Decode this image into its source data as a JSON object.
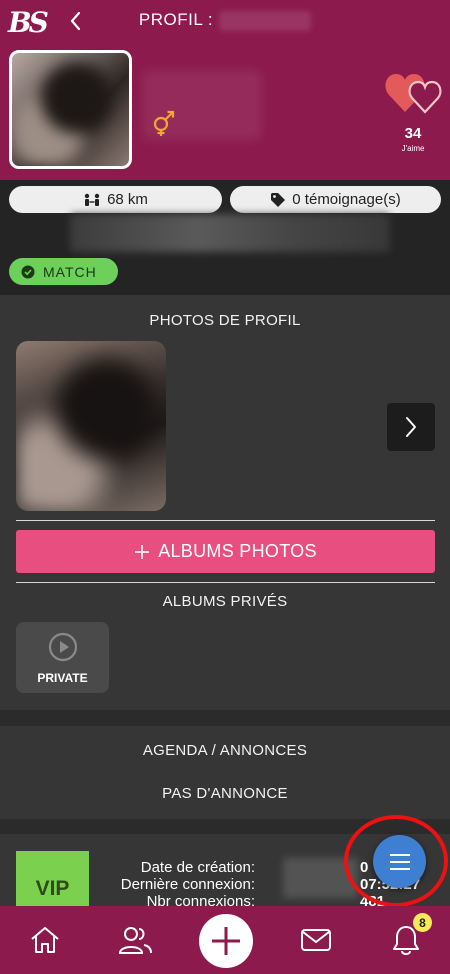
{
  "app": {
    "logo_text": "BS"
  },
  "header": {
    "title": "PROFIL :",
    "likes_count": "34",
    "likes_label": "J'aime"
  },
  "info": {
    "distance": "68 km",
    "testimonials": "0 témoignage(s)",
    "match_label": "MATCH"
  },
  "photos": {
    "section_title": "PHOTOS DE PROFIL",
    "albums_button": "ALBUMS PHOTOS",
    "private_title": "ALBUMS PRIVÉS",
    "private_tile_label": "PRIVATE"
  },
  "agenda": {
    "title": "AGENDA / ANNONCES",
    "empty_text": "PAS D'ANNONCE"
  },
  "vip": {
    "badge": "VIP",
    "rows": [
      {
        "label": "Date de création:",
        "value": "0"
      },
      {
        "label": "Dernière connexion:",
        "value": "07:52:27"
      },
      {
        "label": "Nbr connexions:",
        "value": "481"
      }
    ]
  },
  "nav": {
    "notifications_count": "8"
  },
  "colors": {
    "header_bg": "#8c1a4d",
    "accent_pink": "#e84f80",
    "match_green": "#6cd05a",
    "vip_green": "#7bd14e",
    "fab_blue": "#3f7fd1",
    "highlight_red": "#e11111"
  },
  "icons": {
    "back": "chevron-left-icon",
    "gender": "gender-icon",
    "likes": "hearts-icon",
    "distance": "distance-icon",
    "testimonials": "tag-icon",
    "match": "check-circle-icon",
    "next": "chevron-right-icon",
    "add": "plus-icon",
    "private": "play-icon",
    "menu": "menu-icon",
    "home": "home-icon",
    "contacts": "users-icon",
    "create": "plus-icon",
    "messages": "mail-icon",
    "notifications": "bell-icon"
  }
}
